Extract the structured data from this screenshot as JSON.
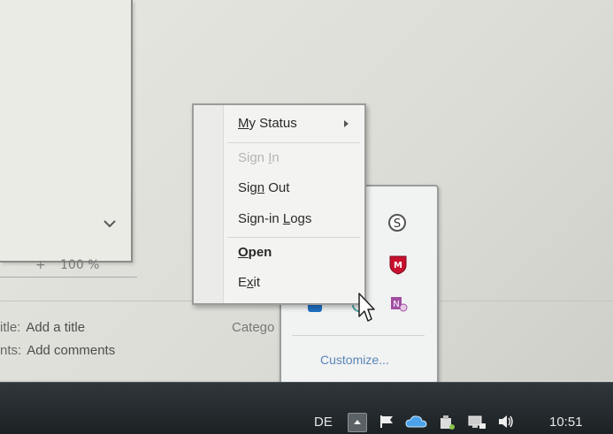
{
  "background": {
    "zoom_plus": "+",
    "zoom_level": "100 %",
    "properties": [
      {
        "label": "itle:",
        "value": "Add a title"
      },
      {
        "label": "nts:",
        "value": "Add comments"
      }
    ],
    "category_label": "Catego"
  },
  "context_menu": {
    "items": [
      {
        "label_pre": "",
        "label_u": "M",
        "label_post": "y Status",
        "disabled": false,
        "bold": false,
        "submenu": true
      },
      {
        "label_pre": "Sign ",
        "label_u": "I",
        "label_post": "n",
        "disabled": true,
        "bold": false,
        "submenu": false
      },
      {
        "label_pre": "Sig",
        "label_u": "n",
        "label_post": " Out",
        "disabled": false,
        "bold": false,
        "submenu": false
      },
      {
        "label_pre": "Sign-in ",
        "label_u": "L",
        "label_post": "ogs",
        "disabled": false,
        "bold": false,
        "submenu": false
      },
      {
        "label_pre": "",
        "label_u": "O",
        "label_post": "pen",
        "disabled": false,
        "bold": true,
        "submenu": false
      },
      {
        "label_pre": "E",
        "label_u": "x",
        "label_post": "it",
        "disabled": false,
        "bold": false,
        "submenu": false
      }
    ]
  },
  "tray_popup": {
    "customize_label": "Customize...",
    "icons": [
      "word-icon",
      "skype-icon",
      "outlook-icon",
      "mcafee-icon",
      "lync-icon",
      "status-icon",
      "onenote-icon"
    ]
  },
  "taskbar": {
    "language": "DE",
    "clock": "10:51",
    "icons": [
      "show-hidden-icons",
      "flag-icon",
      "onedrive-icon",
      "usb-icon",
      "network-icon",
      "volume-icon"
    ]
  },
  "colors": {
    "taskbar": "#1c2124",
    "menu_bg": "#f3f3f1",
    "link": "#5a86b9"
  }
}
